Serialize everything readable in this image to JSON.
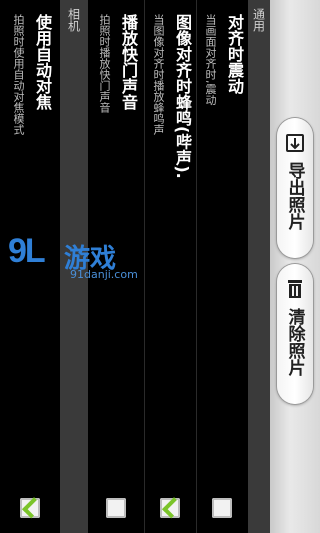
{
  "sections": {
    "general": "通用",
    "camera": "相机"
  },
  "settings": [
    {
      "title": "对齐时震动",
      "subtitle": "当画面对齐时,震动",
      "checked": false
    },
    {
      "title": "图像对齐时蜂鸣(哔声).",
      "subtitle": "当图像对齐时播放蜂鸣声",
      "checked": true
    },
    {
      "title": "播放快门声音",
      "subtitle": "拍照时播放快门声音",
      "checked": false
    },
    {
      "title": "使用自动对焦",
      "subtitle": "拍照时使用自动对焦模式",
      "checked": true
    }
  ],
  "actions": {
    "export_label": "导出照片",
    "clear_label": "清除照片"
  },
  "watermark": {
    "logo": "9L",
    "brand": "游戏",
    "url": "91danji.com"
  },
  "colors": {
    "check_green": "#7bc42a",
    "watermark_blue": "#2f7fd6"
  },
  "icons": [
    "export-icon",
    "trash-icon",
    "checkbox-check-icon"
  ]
}
